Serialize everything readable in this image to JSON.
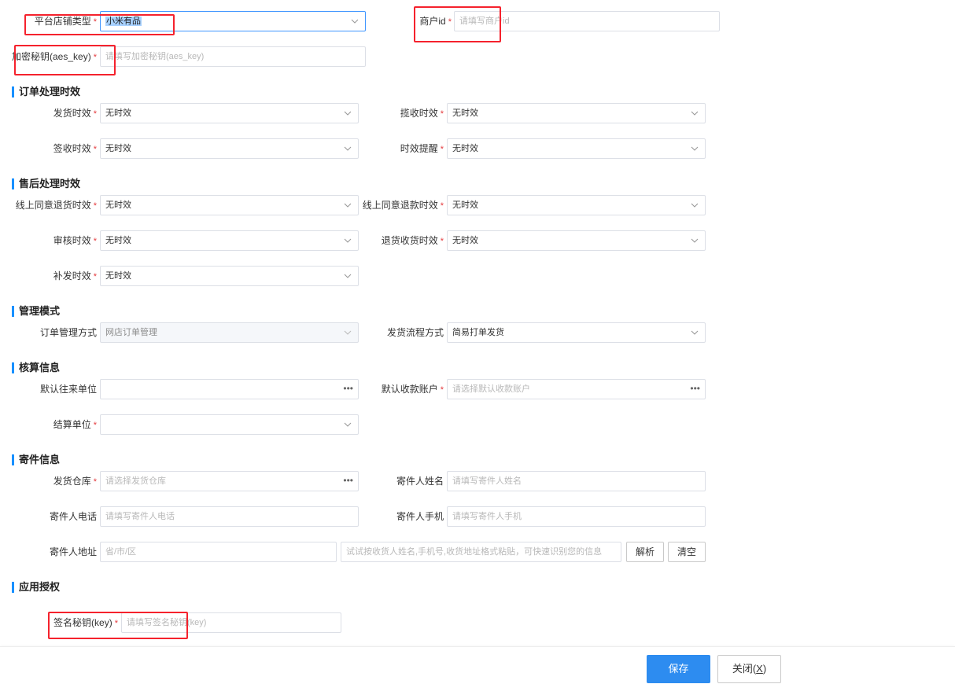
{
  "top": {
    "platform_type": {
      "label": "平台店铺类型",
      "value": "小米有品"
    },
    "merchant_id": {
      "label": "商户id",
      "placeholder": "请填写商户id"
    },
    "aes_key": {
      "label": "加密秘钥(aes_key)",
      "placeholder": "请填写加密秘钥(aes_key)"
    }
  },
  "sections": {
    "order": {
      "title": "订单处理时效",
      "ship_time": {
        "label": "发货时效",
        "value": "无时效"
      },
      "pickup_time": {
        "label": "揽收时效",
        "value": "无时效"
      },
      "sign_time": {
        "label": "签收时效",
        "value": "无时效"
      },
      "reminder": {
        "label": "时效提醒",
        "value": "无时效"
      }
    },
    "aftersale": {
      "title": "售后处理时效",
      "online_return": {
        "label": "线上同意退货时效",
        "value": "无时效"
      },
      "online_refund": {
        "label": "线上同意退款时效",
        "value": "无时效"
      },
      "review": {
        "label": "审核时效",
        "value": "无时效"
      },
      "return_receive": {
        "label": "退货收货时效",
        "value": "无时效"
      },
      "reissue": {
        "label": "补发时效",
        "value": "无时效"
      }
    },
    "mode": {
      "title": "管理模式",
      "order_mgmt": {
        "label": "订单管理方式",
        "value": "网店订单管理"
      },
      "ship_flow": {
        "label": "发货流程方式",
        "value": "简易打单发货"
      }
    },
    "accounting": {
      "title": "核算信息",
      "default_unit": {
        "label": "默认往来单位",
        "value": ""
      },
      "default_account": {
        "label": "默认收款账户",
        "placeholder": "请选择默认收款账户"
      },
      "settle_unit": {
        "label": "结算单位",
        "value": ""
      }
    },
    "sender": {
      "title": "寄件信息",
      "warehouse": {
        "label": "发货仓库",
        "placeholder": "请选择发货仓库"
      },
      "sender_name": {
        "label": "寄件人姓名",
        "placeholder": "请填写寄件人姓名"
      },
      "sender_phone": {
        "label": "寄件人电话",
        "placeholder": "请填写寄件人电话"
      },
      "sender_mobile": {
        "label": "寄件人手机",
        "placeholder": "请填写寄件人手机"
      },
      "sender_addr": {
        "label": "寄件人地址",
        "placeholder": "省/市/区"
      },
      "addr_paste": {
        "placeholder": "试试按收货人姓名,手机号,收货地址格式粘贴，可快速识别您的信息"
      },
      "parse_label": "解析",
      "clear_label": "清空"
    },
    "auth": {
      "title": "应用授权",
      "sign_key": {
        "label": "签名秘钥(key)",
        "placeholder": "请填写签名秘钥(key)"
      }
    }
  },
  "footer": {
    "save_label": "保存",
    "close_label": "关闭",
    "close_hotkey": "X"
  },
  "colors": {
    "accent": "#2d8cf0",
    "section_bar": "#1890ff",
    "required": "#e4393c",
    "highlight_box": "#f5222d"
  },
  "icons": {
    "dropdown": "chevron-down-icon",
    "picker": "ellipsis-icon"
  }
}
